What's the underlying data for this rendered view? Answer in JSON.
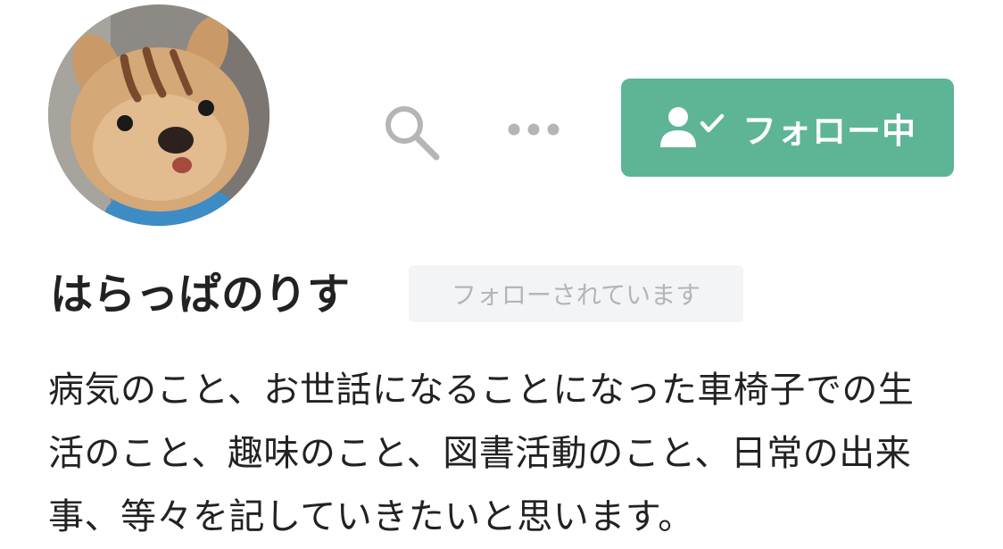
{
  "profile": {
    "avatar_alt": "",
    "username": "はらっぱのりす",
    "follows_you_badge": "フォローされています",
    "bio": "病気のこと、お世話になることになった車椅子での生活のこと、趣味のこと、図書活動のこと、日常の出来事、等々を記していきたいと思います。"
  },
  "actions": {
    "follow_label": "フォロー中",
    "follow_icon": "user-check-icon",
    "search_icon": "search-icon",
    "more_icon": "more-horizontal-icon"
  },
  "colors": {
    "accent": "#5db595",
    "badge_bg": "#f3f4f5",
    "badge_text": "#b2b6ba",
    "icon_gray": "#b5b5b5",
    "text": "#222222"
  }
}
